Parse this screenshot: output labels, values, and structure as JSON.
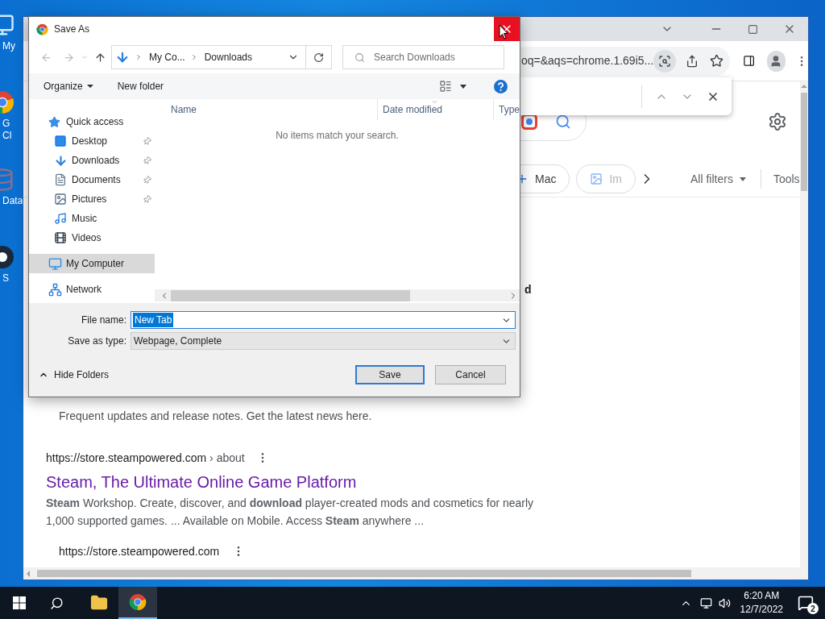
{
  "desktop_icons": [
    {
      "kind": "computer",
      "label_lines": [
        "My"
      ]
    },
    {
      "kind": "chrome",
      "label_lines": [
        "G",
        "Cl"
      ]
    },
    {
      "kind": "database",
      "label_lines": [
        "Data"
      ]
    },
    {
      "kind": "steam",
      "label_lines": [
        "S"
      ]
    }
  ],
  "browser": {
    "address_text": "oq=&aqs=chrome.1.69i5...",
    "chips": [
      {
        "kind": "plus",
        "label": "Mac"
      },
      {
        "kind": "image",
        "label": "Im"
      }
    ],
    "all_filters": "All filters",
    "tools": "Tools",
    "fragment": "d",
    "results": [
      {
        "kind": "snippet_only",
        "snippet": "Frequent updates and release notes. Get the latest news here."
      },
      {
        "kind": "full",
        "url": "https://store.steampowered.com",
        "path": "› about",
        "title": "Steam, The Ultimate Online Game Platform",
        "snippet": "**Steam** Workshop. Create, discover, and **download** player-created mods and cosmetics for nearly 1,000 supported games. ... Available on Mobile. Access **Steam** anywhere ..."
      },
      {
        "kind": "url_only",
        "url": "https://store.steampowered.com"
      }
    ]
  },
  "dialog": {
    "title": "Save As",
    "breadcrumb": [
      "My Co...",
      "Downloads"
    ],
    "search_placeholder": "Search Downloads",
    "toolbar": {
      "organize": "Organize",
      "new_folder": "New folder"
    },
    "nav_tree": [
      {
        "kind": "quick",
        "label": "Quick access",
        "selected": false,
        "children": [
          {
            "kind": "desktop",
            "label": "Desktop",
            "pinned": true,
            "selected": false
          },
          {
            "kind": "downloads",
            "label": "Downloads",
            "pinned": true,
            "selected": false
          },
          {
            "kind": "documents",
            "label": "Documents",
            "pinned": true,
            "selected": false
          },
          {
            "kind": "pictures",
            "label": "Pictures",
            "pinned": true,
            "selected": false
          },
          {
            "kind": "music",
            "label": "Music",
            "pinned": false,
            "selected": false
          },
          {
            "kind": "videos",
            "label": "Videos",
            "pinned": false,
            "selected": false
          }
        ]
      },
      {
        "kind": "computer",
        "label": "My Computer",
        "selected": true
      },
      {
        "kind": "network",
        "label": "Network",
        "selected": false
      }
    ],
    "columns": [
      "Name",
      "Date modified",
      "Type"
    ],
    "empty_message": "No items match your search.",
    "file_name_label": "File name:",
    "file_name": "New Tab",
    "save_type_label": "Save as type:",
    "save_type": "Webpage, Complete",
    "hide_folders": "Hide Folders",
    "save": "Save",
    "cancel": "Cancel"
  },
  "taskbar": {
    "apps": [
      {
        "kind": "explorer",
        "active": false
      },
      {
        "kind": "chrome",
        "active": true
      }
    ],
    "time": "6:20 AM",
    "date": "12/7/2022",
    "notifications": "2"
  }
}
